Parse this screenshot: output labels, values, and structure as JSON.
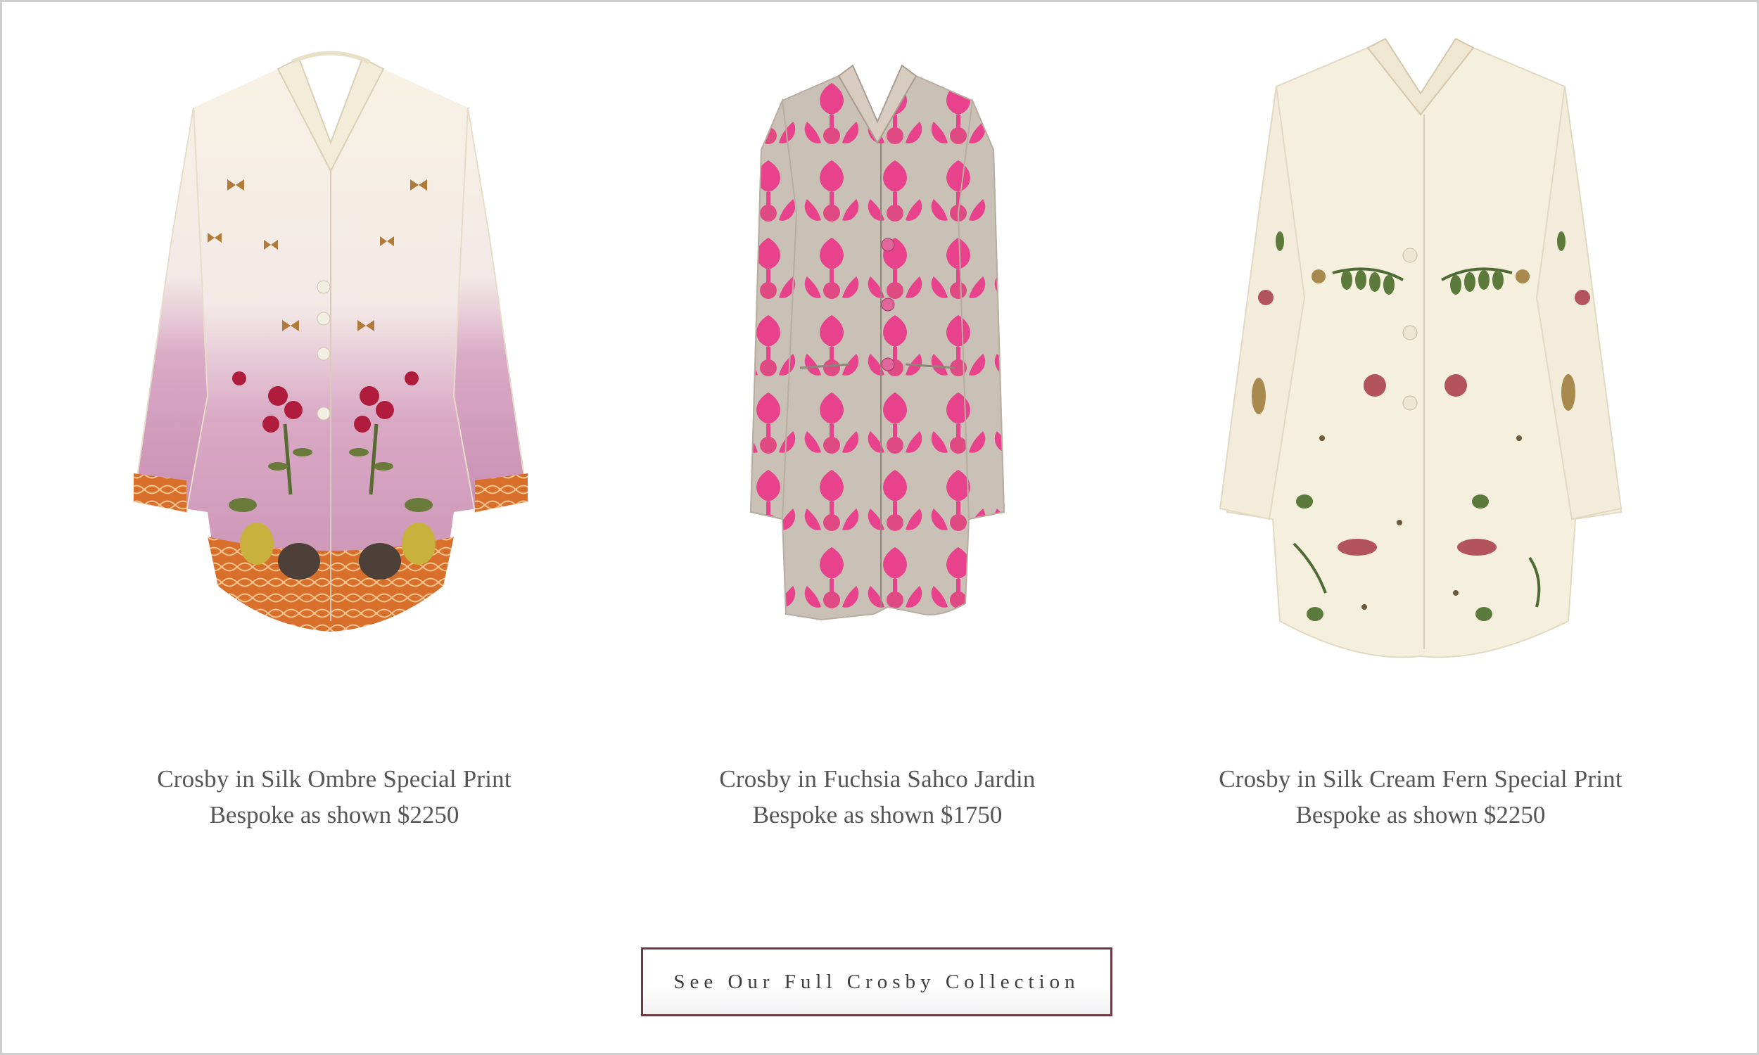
{
  "products": [
    {
      "name": "Crosby in Silk Ombre Special Print",
      "price": "Bespoke as shown $2250",
      "image_desc": "ombre-butterfly-jacket"
    },
    {
      "name": "Crosby in Fuchsia Sahco Jardin",
      "price": "Bespoke as shown $1750",
      "image_desc": "fuchsia-damask-jacket"
    },
    {
      "name": "Crosby in Silk Cream Fern Special Print",
      "price": "Bespoke as shown $2250",
      "image_desc": "cream-fern-jacket"
    }
  ],
  "cta": {
    "label": "See Our Full Crosby Collection"
  },
  "colors": {
    "text": "#555555",
    "button_border": "#6b3a44",
    "page_border": "#cfcfcf"
  }
}
